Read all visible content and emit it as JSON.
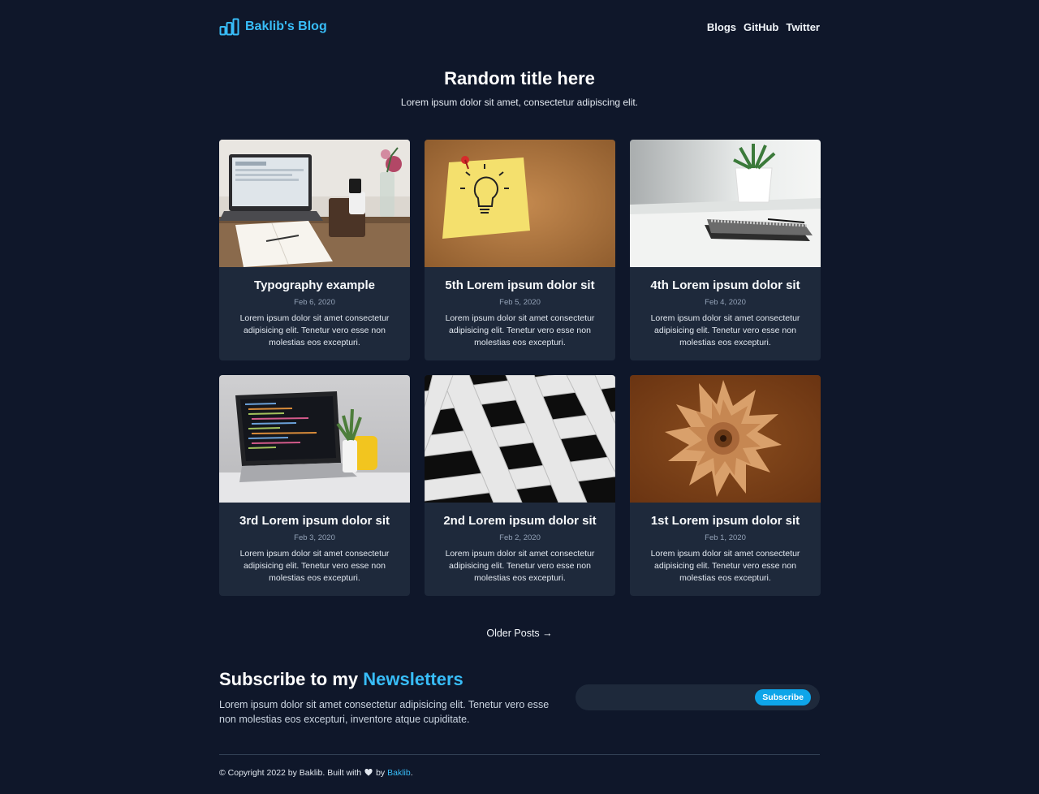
{
  "header": {
    "brand": "Baklib's Blog",
    "logo_icon": "bar-chart-icon",
    "nav": [
      "Blogs",
      "GitHub",
      "Twitter"
    ]
  },
  "hero": {
    "title": "Random title here",
    "subtitle": "Lorem ipsum dolor sit amet, consectetur adipiscing elit."
  },
  "posts": [
    {
      "title": "Typography example",
      "date": "Feb 6, 2020",
      "excerpt": "Lorem ipsum dolor sit amet consectetur adipisicing elit. Tenetur vero esse non molestias eos excepturi.",
      "image": "laptop-desk-image"
    },
    {
      "title": "5th Lorem ipsum dolor sit",
      "date": "Feb 5, 2020",
      "excerpt": "Lorem ipsum dolor sit amet consectetur adipisicing elit. Tenetur vero esse non molestias eos excepturi.",
      "image": "lightbulb-note-image"
    },
    {
      "title": "4th Lorem ipsum dolor sit",
      "date": "Feb 4, 2020",
      "excerpt": "Lorem ipsum dolor sit amet consectetur adipisicing elit. Tenetur vero esse non molestias eos excepturi.",
      "image": "notebook-plant-image"
    },
    {
      "title": "3rd Lorem ipsum dolor sit",
      "date": "Feb 3, 2020",
      "excerpt": "Lorem ipsum dolor sit amet consectetur adipisicing elit. Tenetur vero esse non molestias eos excepturi.",
      "image": "code-laptop-image"
    },
    {
      "title": "2nd Lorem ipsum dolor sit",
      "date": "Feb 2, 2020",
      "excerpt": "Lorem ipsum dolor sit amet consectetur adipisicing elit. Tenetur vero esse non molestias eos excepturi.",
      "image": "building-facade-image"
    },
    {
      "title": "1st Lorem ipsum dolor sit",
      "date": "Feb 1, 2020",
      "excerpt": "Lorem ipsum dolor sit amet consectetur adipisicing elit. Tenetur vero esse non molestias eos excepturi.",
      "image": "paper-flower-image"
    }
  ],
  "pagination": {
    "older": "Older Posts →"
  },
  "newsletter": {
    "title_prefix": "Subscribe to my",
    "title_accent": "Newsletters",
    "text": "Lorem ipsum dolor sit amet consectetur adipisicing elit. Tenetur vero esse non molestias eos excepturi, inventore atque cupiditate.",
    "input_placeholder": "",
    "button": "Subscribe"
  },
  "footer": {
    "text_before": "© Copyright 2022 by Baklib. Built with",
    "heart_icon": "heart-icon",
    "text_by": "by",
    "link": "Baklib",
    "text_after": "."
  },
  "colors": {
    "background": "#0f172a",
    "card": "#1e293b",
    "accent": "#38bdf8",
    "button": "#0ea5e9"
  }
}
